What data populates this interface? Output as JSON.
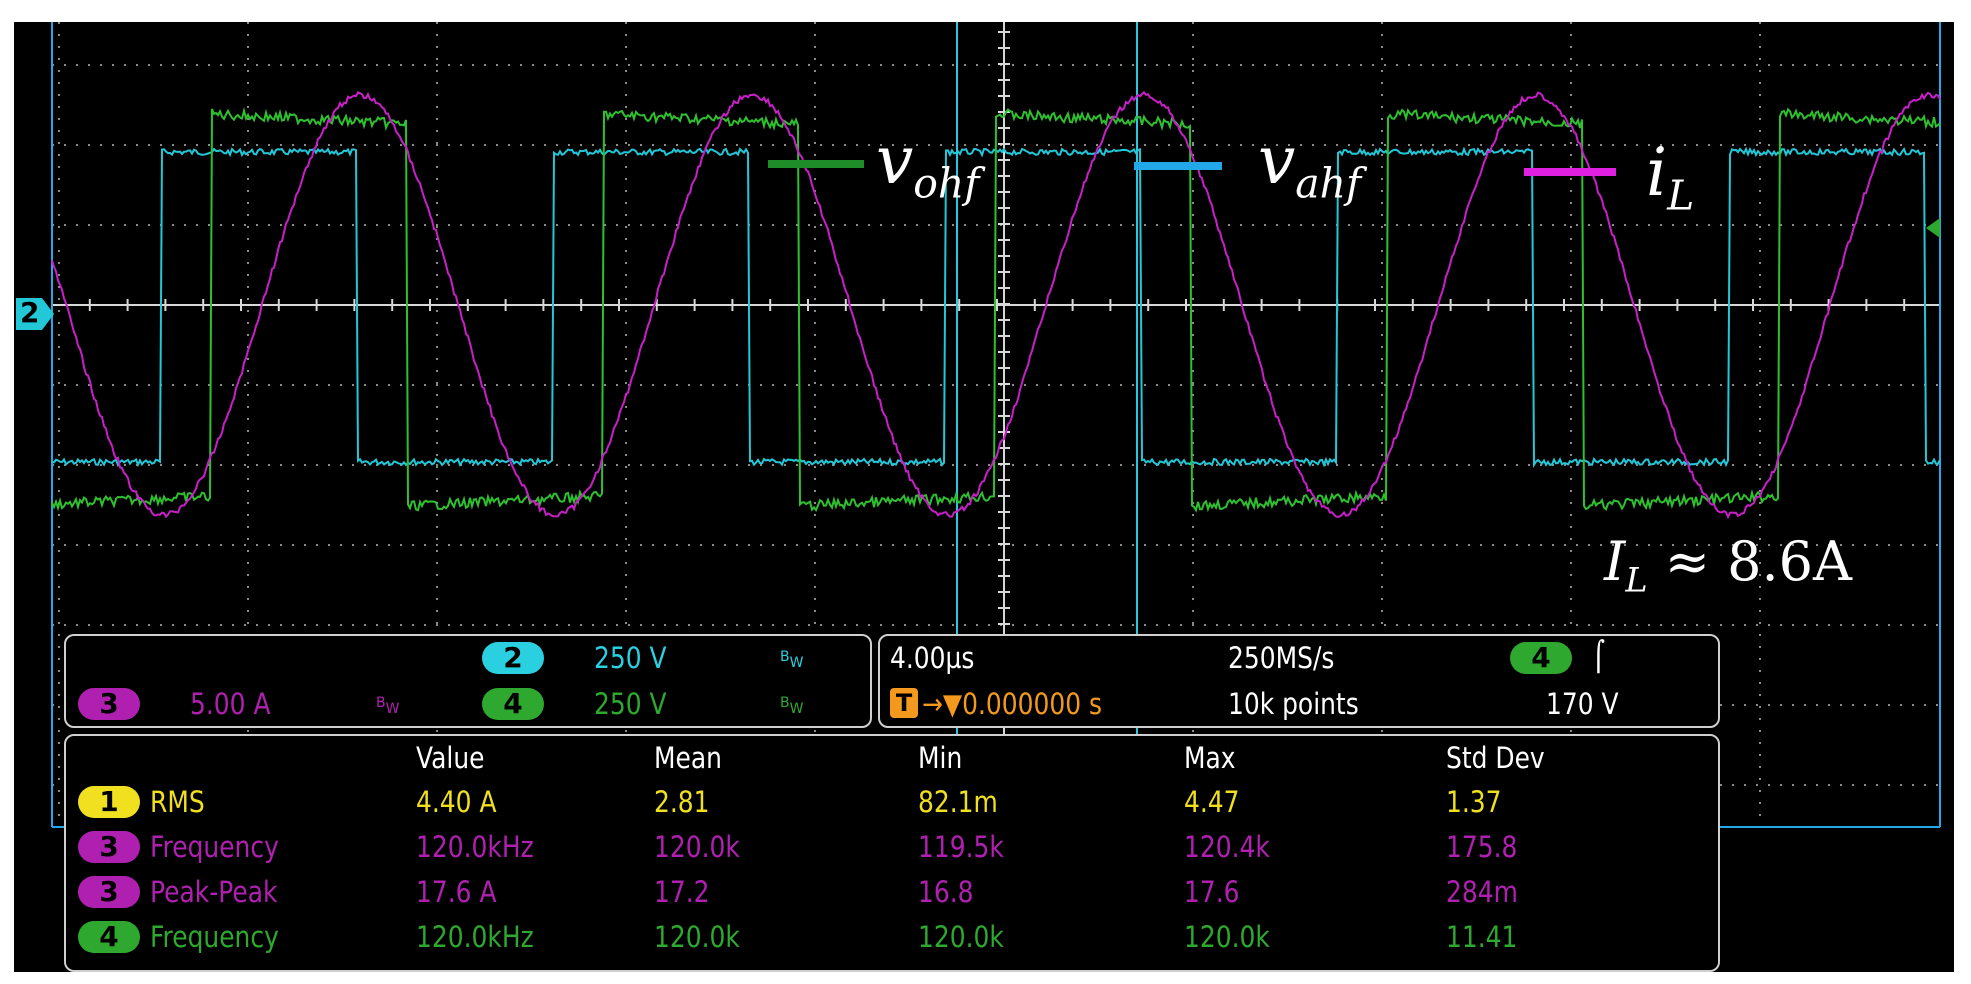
{
  "scope": {
    "ground_marker": "2",
    "traces": {
      "ch2_color": "#22c8d8",
      "ch3_color": "#c81fc8",
      "ch4_color": "#2fc02f"
    },
    "legend": [
      {
        "sym": "v",
        "sub": "ohf",
        "color": "#1e8c28"
      },
      {
        "sym": "v",
        "sub": "ahf",
        "color": "#22a8e8"
      },
      {
        "sym": "i",
        "sub": "L",
        "color": "#e020e0"
      }
    ],
    "annotation": {
      "sym": "I",
      "sub": "L",
      "rest": " ≈ 8.6A"
    }
  },
  "channels": {
    "ch2": {
      "badge": "2",
      "scale": "250 V",
      "bw": "B",
      "bw_sub": "W",
      "color": "#2ad0e0"
    },
    "ch3": {
      "badge": "3",
      "scale": "5.00 A",
      "bw": "B",
      "bw_sub": "W",
      "color": "#b020b0"
    },
    "ch4": {
      "badge": "4",
      "scale": "250 V",
      "bw": "B",
      "bw_sub": "W",
      "color": "#2ea82e"
    }
  },
  "timebase": {
    "horizontal": "4.00µs",
    "sample_rate": "250MS/s",
    "trigger_badge": "T",
    "trigger_delay": "→▼0.000000 s",
    "record_length": "10k points",
    "trigger_source": "4",
    "trigger_slope": "⌠",
    "trigger_level": "170 V"
  },
  "measurements": {
    "headers": [
      "Value",
      "Mean",
      "Min",
      "Max",
      "Std Dev"
    ],
    "rows": [
      {
        "ch": "1",
        "name": "RMS",
        "values": [
          "4.40 A",
          "2.81",
          "82.1m",
          "4.47",
          "1.37"
        ],
        "color": "#f0e020",
        "badge": "#f0e020"
      },
      {
        "ch": "3",
        "name": "Frequency",
        "values": [
          "120.0kHz",
          "120.0k",
          "119.5k",
          "120.4k",
          "175.8"
        ],
        "color": "#b020b0",
        "badge": "#b020b0"
      },
      {
        "ch": "3",
        "name": "Peak-Peak",
        "values": [
          "17.6 A",
          "17.2",
          "16.8",
          "17.6",
          "284m"
        ],
        "color": "#b020b0",
        "badge": "#b020b0"
      },
      {
        "ch": "4",
        "name": "Frequency",
        "values": [
          "120.0kHz",
          "120.0k",
          "120.0k",
          "120.0k",
          "11.41"
        ],
        "color": "#2ea82e",
        "badge": "#2ea82e"
      }
    ]
  }
}
